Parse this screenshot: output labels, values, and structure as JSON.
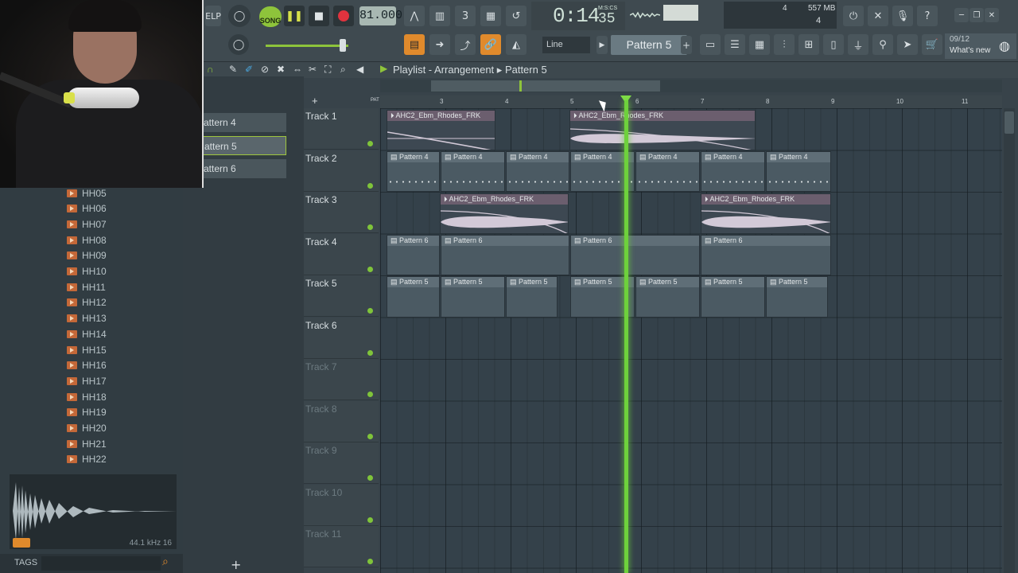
{
  "toolbar": {
    "help_label": "ELP",
    "song_label": "SONG",
    "tempo": "81.000",
    "time_main": "0:14",
    "time_sub": "M:S:CS",
    "time_cs": "35",
    "memory": "557 MB",
    "cpu_polyphony": "4",
    "cpu_voices": "4",
    "snap": "Line",
    "pattern": "Pattern 5",
    "news_date": "09/12",
    "news_label": "What's new",
    "accent": "#e08a2c",
    "song_color": "#8ec43b"
  },
  "playlist": {
    "title": "Playlist - Arrangement",
    "pattern_crumb": "Pattern 5",
    "ruler": [
      "3",
      "4",
      "5",
      "6",
      "7",
      "8",
      "9",
      "10",
      "11"
    ],
    "tracks": [
      "Track 1",
      "Track 2",
      "Track 3",
      "Track 4",
      "Track 5",
      "Track 6",
      "Track 7",
      "Track 8",
      "Track 9",
      "Track 10",
      "Track 11"
    ],
    "audio_clip": "AHC2_Ebm_Rhodes_FRK",
    "pattern4": "Pattern 4",
    "pattern5": "Pattern 5",
    "pattern6": "Pattern 6",
    "playhead_color": "#6ed13c"
  },
  "patterns_panel": {
    "items": [
      "attern 4",
      "attern 5",
      "attern 6"
    ]
  },
  "browser": {
    "items": [
      "HH05",
      "HH06",
      "HH07",
      "HH08",
      "HH09",
      "HH10",
      "HH11",
      "HH12",
      "HH13",
      "HH14",
      "HH15",
      "HH16",
      "HH17",
      "HH18",
      "HH19",
      "HH20",
      "HH21",
      "HH22"
    ],
    "sample_info": "44.1 kHz 16",
    "tags_label": "TAGS"
  }
}
